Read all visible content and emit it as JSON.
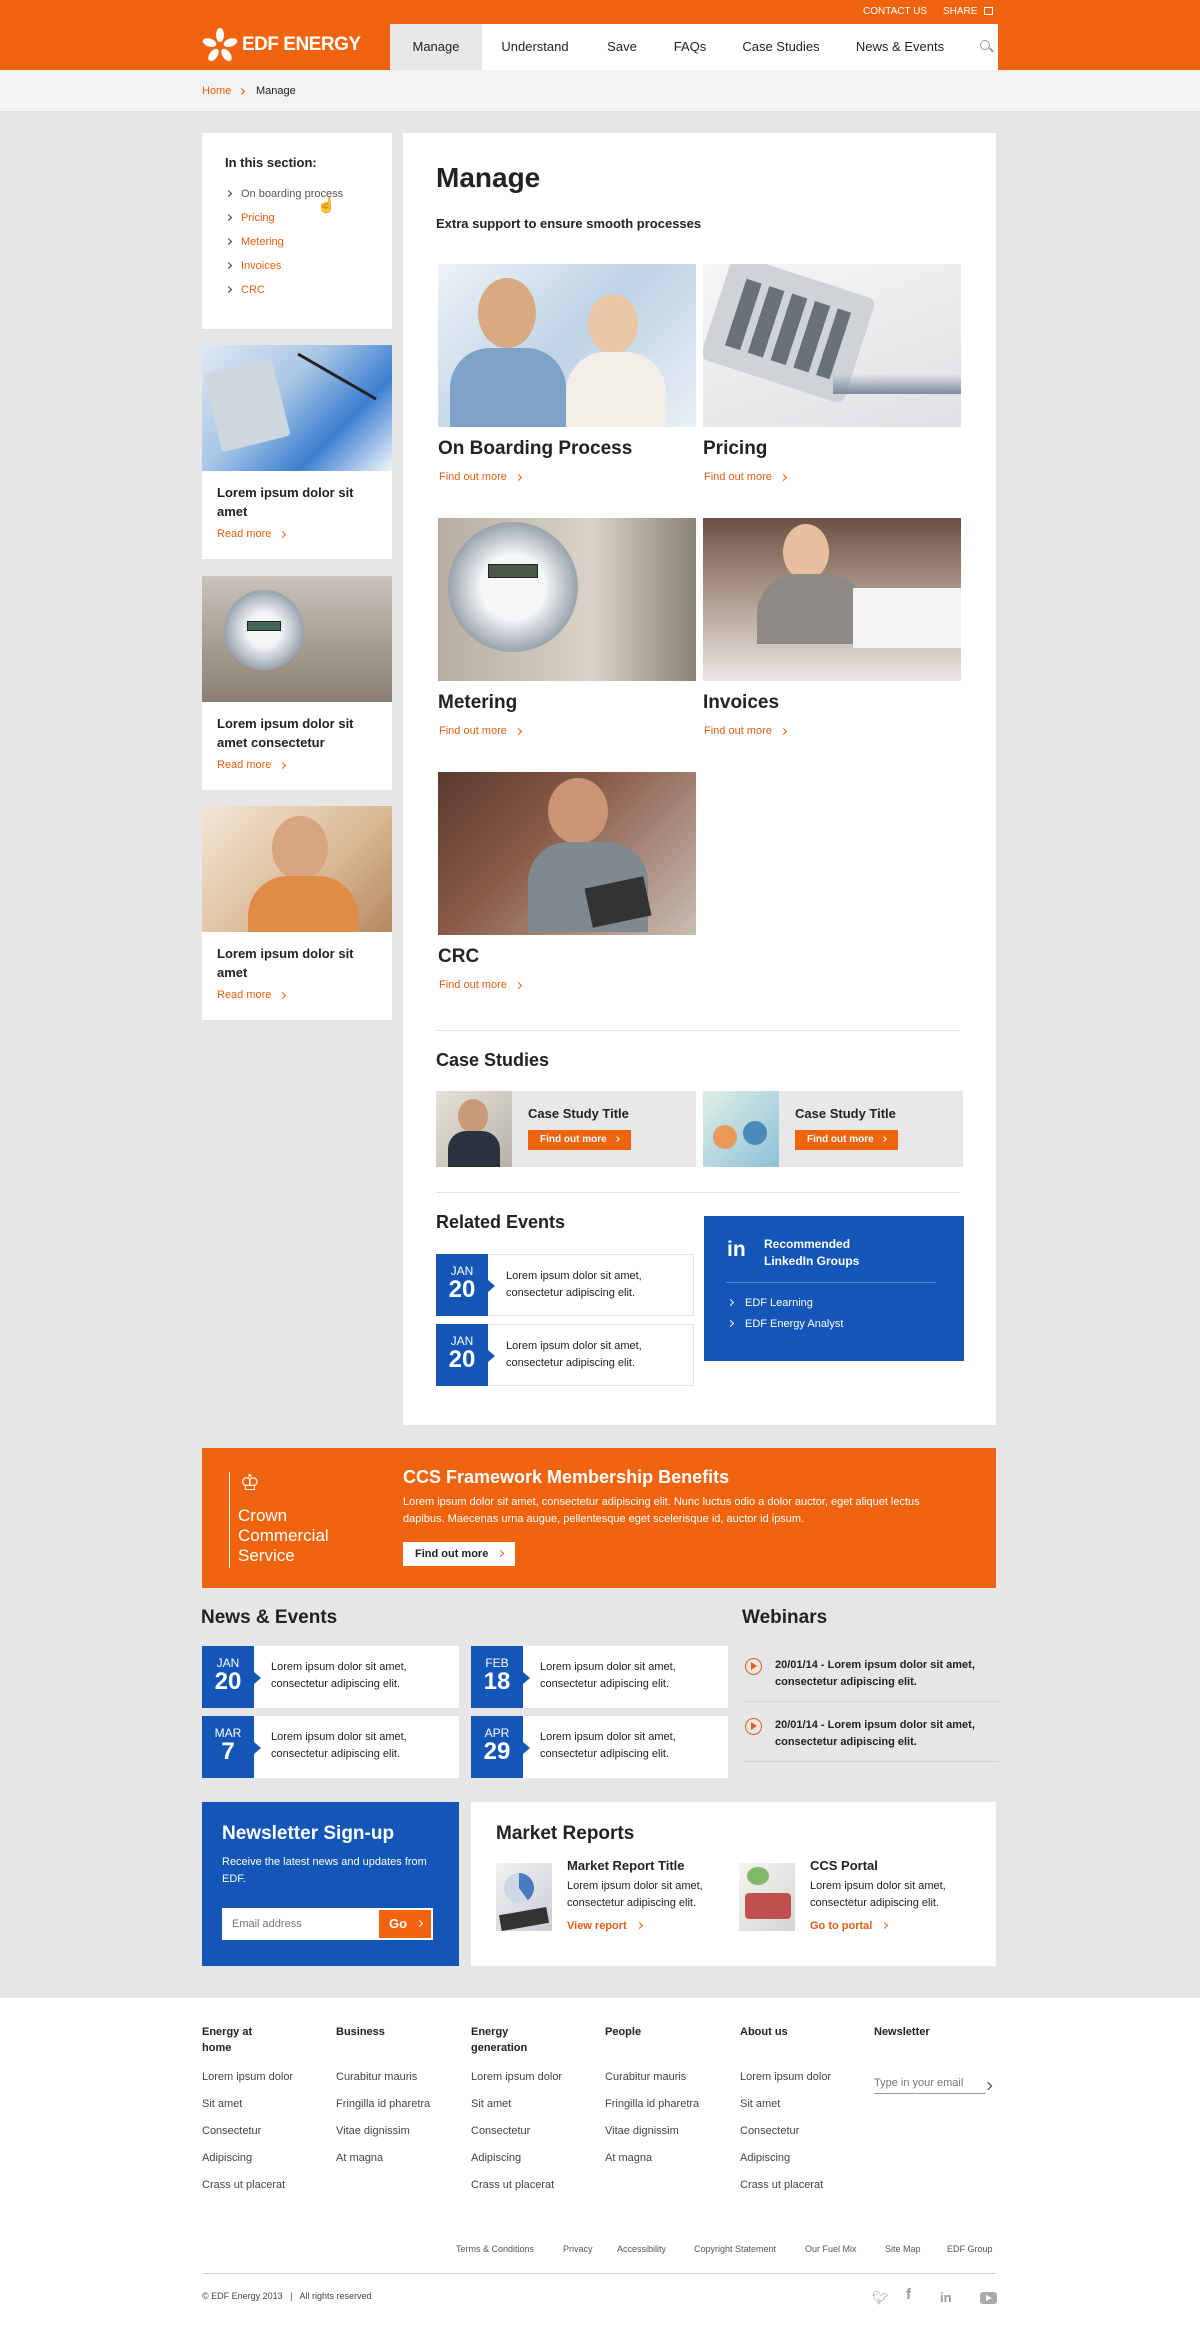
{
  "topbar": {
    "contact": "CONTACT US",
    "share": "SHARE"
  },
  "brand": {
    "name": "EDF ENERGY",
    "color": "#f0640f",
    "secondary": "#1456b8"
  },
  "nav": {
    "items": [
      {
        "label": "Manage",
        "active": true
      },
      {
        "label": "Understand"
      },
      {
        "label": "Save"
      },
      {
        "label": "FAQs"
      },
      {
        "label": "Case Studies"
      },
      {
        "label": "News & Events"
      }
    ],
    "search_icon": "search-icon"
  },
  "breadcrumb": {
    "home": "Home",
    "current": "Manage"
  },
  "sidebar": {
    "heading": "In this section:",
    "items": [
      "On boarding process",
      "Pricing",
      "Metering",
      "Invoices",
      "CRC"
    ],
    "promos": [
      {
        "title": "Lorem ipsum dolor sit amet",
        "link": "Read more"
      },
      {
        "title": "Lorem ipsum dolor sit amet consectetur",
        "link": "Read more"
      },
      {
        "title": "Lorem ipsum dolor sit amet",
        "link": "Read more"
      }
    ]
  },
  "main": {
    "title": "Manage",
    "subtitle": "Extra support to ensure smooth processes",
    "tiles": [
      {
        "title": "On Boarding Process",
        "link": "Find out more"
      },
      {
        "title": "Pricing",
        "link": "Find out more"
      },
      {
        "title": "Metering",
        "link": "Find out more"
      },
      {
        "title": "Invoices",
        "link": "Find out more"
      },
      {
        "title": "CRC",
        "link": "Find out more"
      }
    ],
    "case_studies": {
      "heading": "Case Studies",
      "items": [
        {
          "title": "Case Study Title",
          "button": "Find out more"
        },
        {
          "title": "Case Study Title",
          "button": "Find out more"
        }
      ]
    },
    "related_events": {
      "heading": "Related Events",
      "items": [
        {
          "month": "JAN",
          "day": "20",
          "text": "Lorem ipsum dolor sit amet, consectetur adipiscing elit."
        },
        {
          "month": "JAN",
          "day": "20",
          "text": "Lorem ipsum dolor sit amet, consectetur adipiscing elit."
        }
      ]
    },
    "linkedin": {
      "heading": "Recommended LinkedIn Groups",
      "items": [
        "EDF Learning",
        "EDF Energy Analyst"
      ]
    }
  },
  "ccs": {
    "logo_lines": [
      "Crown",
      "Commercial",
      "Service"
    ],
    "title": "CCS Framework Membership Benefits",
    "body": "Lorem ipsum dolor sit amet, consectetur adipiscing elit. Nunc luctus odio a dolor auctor, eget aliquet lectus dapibus. Maecenas urna augue, pellentesque eget scelerisque id, auctor id ipsum.",
    "button": "Find out more"
  },
  "news": {
    "heading": "News & Events",
    "items": [
      {
        "month": "JAN",
        "day": "20",
        "text": "Lorem ipsum dolor sit amet, consectetur adipiscing elit."
      },
      {
        "month": "FEB",
        "day": "18",
        "text": "Lorem ipsum dolor sit amet, consectetur adipiscing elit."
      },
      {
        "month": "MAR",
        "day": "7",
        "text": "Lorem ipsum dolor sit amet, consectetur adipiscing elit."
      },
      {
        "month": "APR",
        "day": "29",
        "text": "Lorem ipsum dolor sit amet, consectetur adipiscing elit."
      }
    ]
  },
  "webinars": {
    "heading": "Webinars",
    "items": [
      "20/01/14 - Lorem ipsum dolor sit amet, consectetur adipiscing elit.",
      "20/01/14 - Lorem ipsum dolor sit amet, consectetur adipiscing elit."
    ]
  },
  "newsletter": {
    "heading": "Newsletter Sign-up",
    "body": "Receive the latest news and updates from EDF.",
    "placeholder": "Email address",
    "button": "Go"
  },
  "market": {
    "heading": "Market Reports",
    "items": [
      {
        "title": "Market Report Title",
        "text": "Lorem ipsum dolor sit amet, consectetur adipiscing elit.",
        "link": "View report"
      },
      {
        "title": "CCS Portal",
        "text": "Lorem ipsum dolor sit amet, consectetur adipiscing elit.",
        "link": "Go to portal"
      }
    ]
  },
  "footer": {
    "columns": [
      {
        "heading": "Energy at home",
        "links": [
          "Lorem ipsum dolor",
          "Sit amet",
          "Consectetur",
          "Adipiscing",
          "Crass ut placerat"
        ]
      },
      {
        "heading": "Business",
        "links": [
          "Curabitur mauris",
          "Fringilla id pharetra",
          "Vitae dignissim",
          "At magna"
        ]
      },
      {
        "heading": "Energy generation",
        "links": [
          "Lorem ipsum dolor",
          "Sit amet",
          "Consectetur",
          "Adipiscing",
          "Crass ut placerat"
        ]
      },
      {
        "heading": "People",
        "links": [
          "Curabitur mauris",
          "Fringilla id pharetra",
          "Vitae dignissim",
          "At magna"
        ]
      },
      {
        "heading": "About us",
        "links": [
          "Lorem ipsum dolor",
          "Sit amet",
          "Consectetur",
          "Adipiscing",
          "Crass ut placerat"
        ]
      }
    ],
    "newsletter": {
      "heading": "Newsletter",
      "placeholder": "Type in your email"
    },
    "legal": [
      "Terms & Conditions",
      "Privacy",
      "Accessibility",
      "Copyright Statement",
      "Our Fuel Mix",
      "Site Map",
      "EDF Group"
    ],
    "copyright": "© EDF Energy 2013   |   All rights reserved",
    "social": [
      "twitter-icon",
      "facebook-icon",
      "linkedin-icon",
      "youtube-icon"
    ]
  }
}
